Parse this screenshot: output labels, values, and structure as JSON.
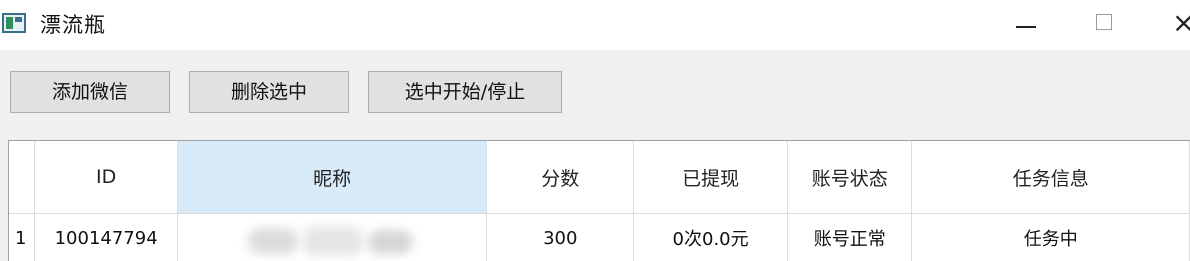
{
  "window": {
    "title": "漂流瓶",
    "controls": {
      "minimize": "—",
      "maximize": "□",
      "close": "×"
    }
  },
  "toolbar": {
    "add_label": "添加微信",
    "delete_label": "删除选中",
    "toggle_label": "选中开始/停止"
  },
  "table": {
    "columns": [
      "",
      "ID",
      "昵称",
      "分数",
      "已提现",
      "账号状态",
      "任务信息"
    ],
    "selected_column": "昵称",
    "rows": [
      {
        "row_number": "1",
        "id": "100147794",
        "nickname": "",
        "score": "300",
        "withdrawn": "0次0.0元",
        "status": "账号正常",
        "task_info": "任务中"
      }
    ]
  },
  "colors": {
    "selected_header": "#d9ebf9",
    "window_background": "#f0f0f0",
    "button_background": "#e1e1e1"
  }
}
